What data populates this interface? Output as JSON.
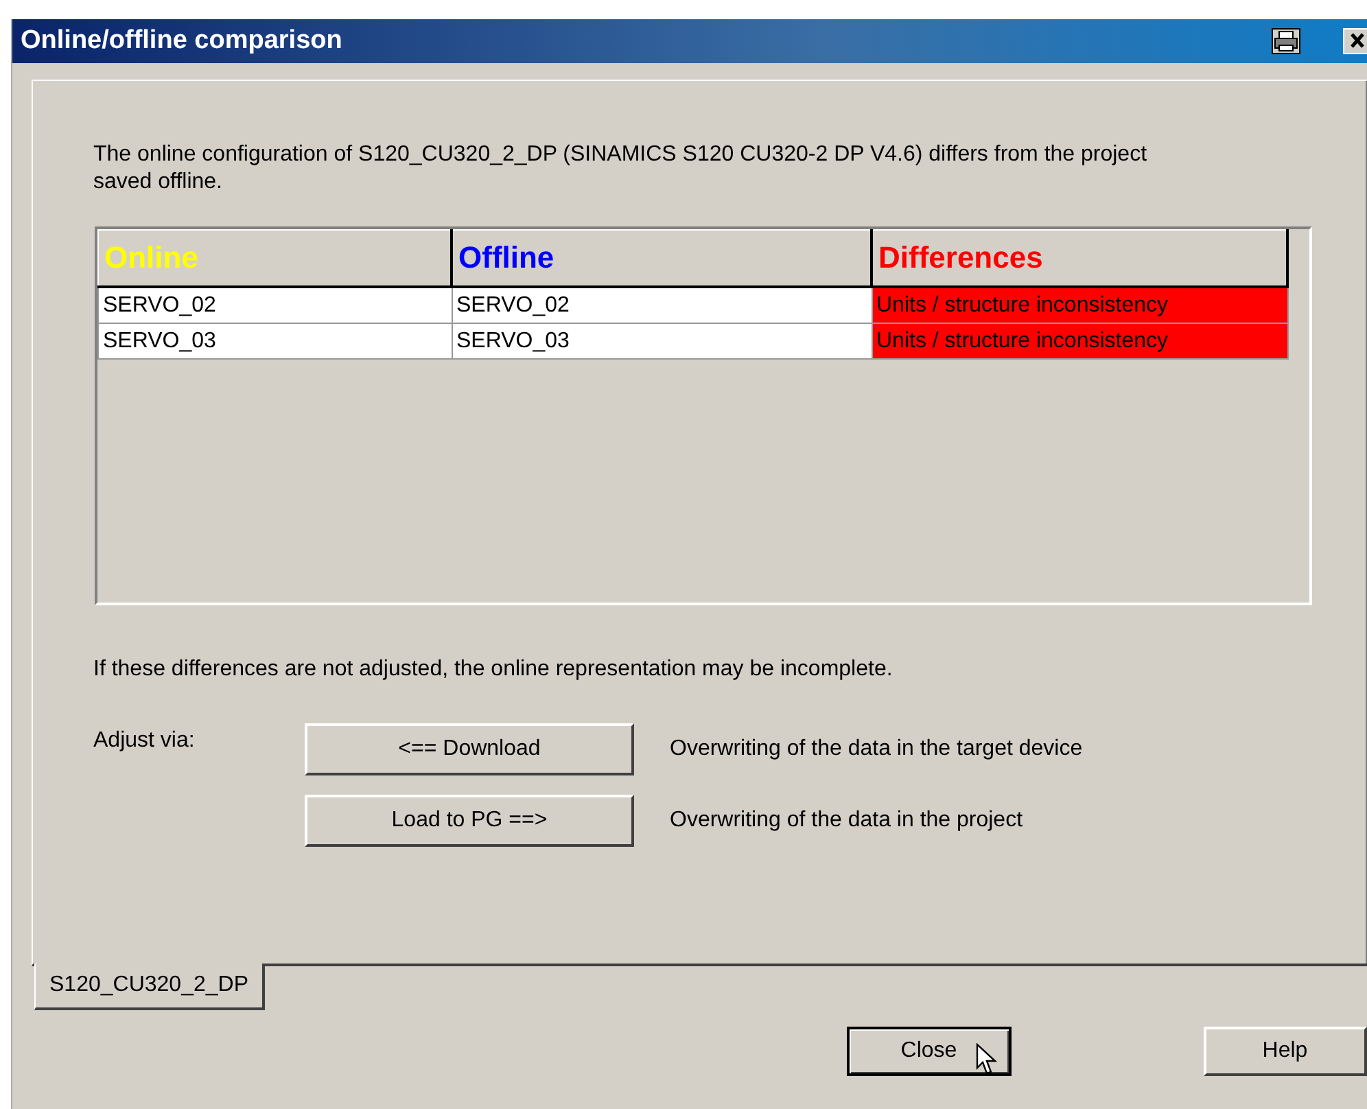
{
  "window": {
    "title": "Online/offline comparison"
  },
  "message": "The online configuration of S120_CU320_2_DP (SINAMICS S120 CU320-2 DP V4.6) differs from the project saved offline.",
  "table": {
    "columns": [
      {
        "label": "Online",
        "color": "#ffff00"
      },
      {
        "label": "Offline",
        "color": "#0000ff"
      },
      {
        "label": "Differences",
        "color": "#ff0000"
      }
    ],
    "rows": [
      [
        "SERVO_02",
        "SERVO_02",
        "Units / structure inconsistency"
      ],
      [
        "SERVO_03",
        "SERVO_03",
        "Units / structure inconsistency"
      ]
    ]
  },
  "note": "If these differences are not adjusted, the online representation may be incomplete.",
  "adjust_label": "Adjust via:",
  "actions": [
    {
      "button": "<== Download",
      "description": "Overwriting of the data in the target device"
    },
    {
      "button": "Load to PG ==>",
      "description": "Overwriting of the data in the project"
    }
  ],
  "tabs": [
    {
      "label": "S120_CU320_2_DP",
      "selected": true
    }
  ],
  "buttons": [
    "Close",
    "Help"
  ]
}
